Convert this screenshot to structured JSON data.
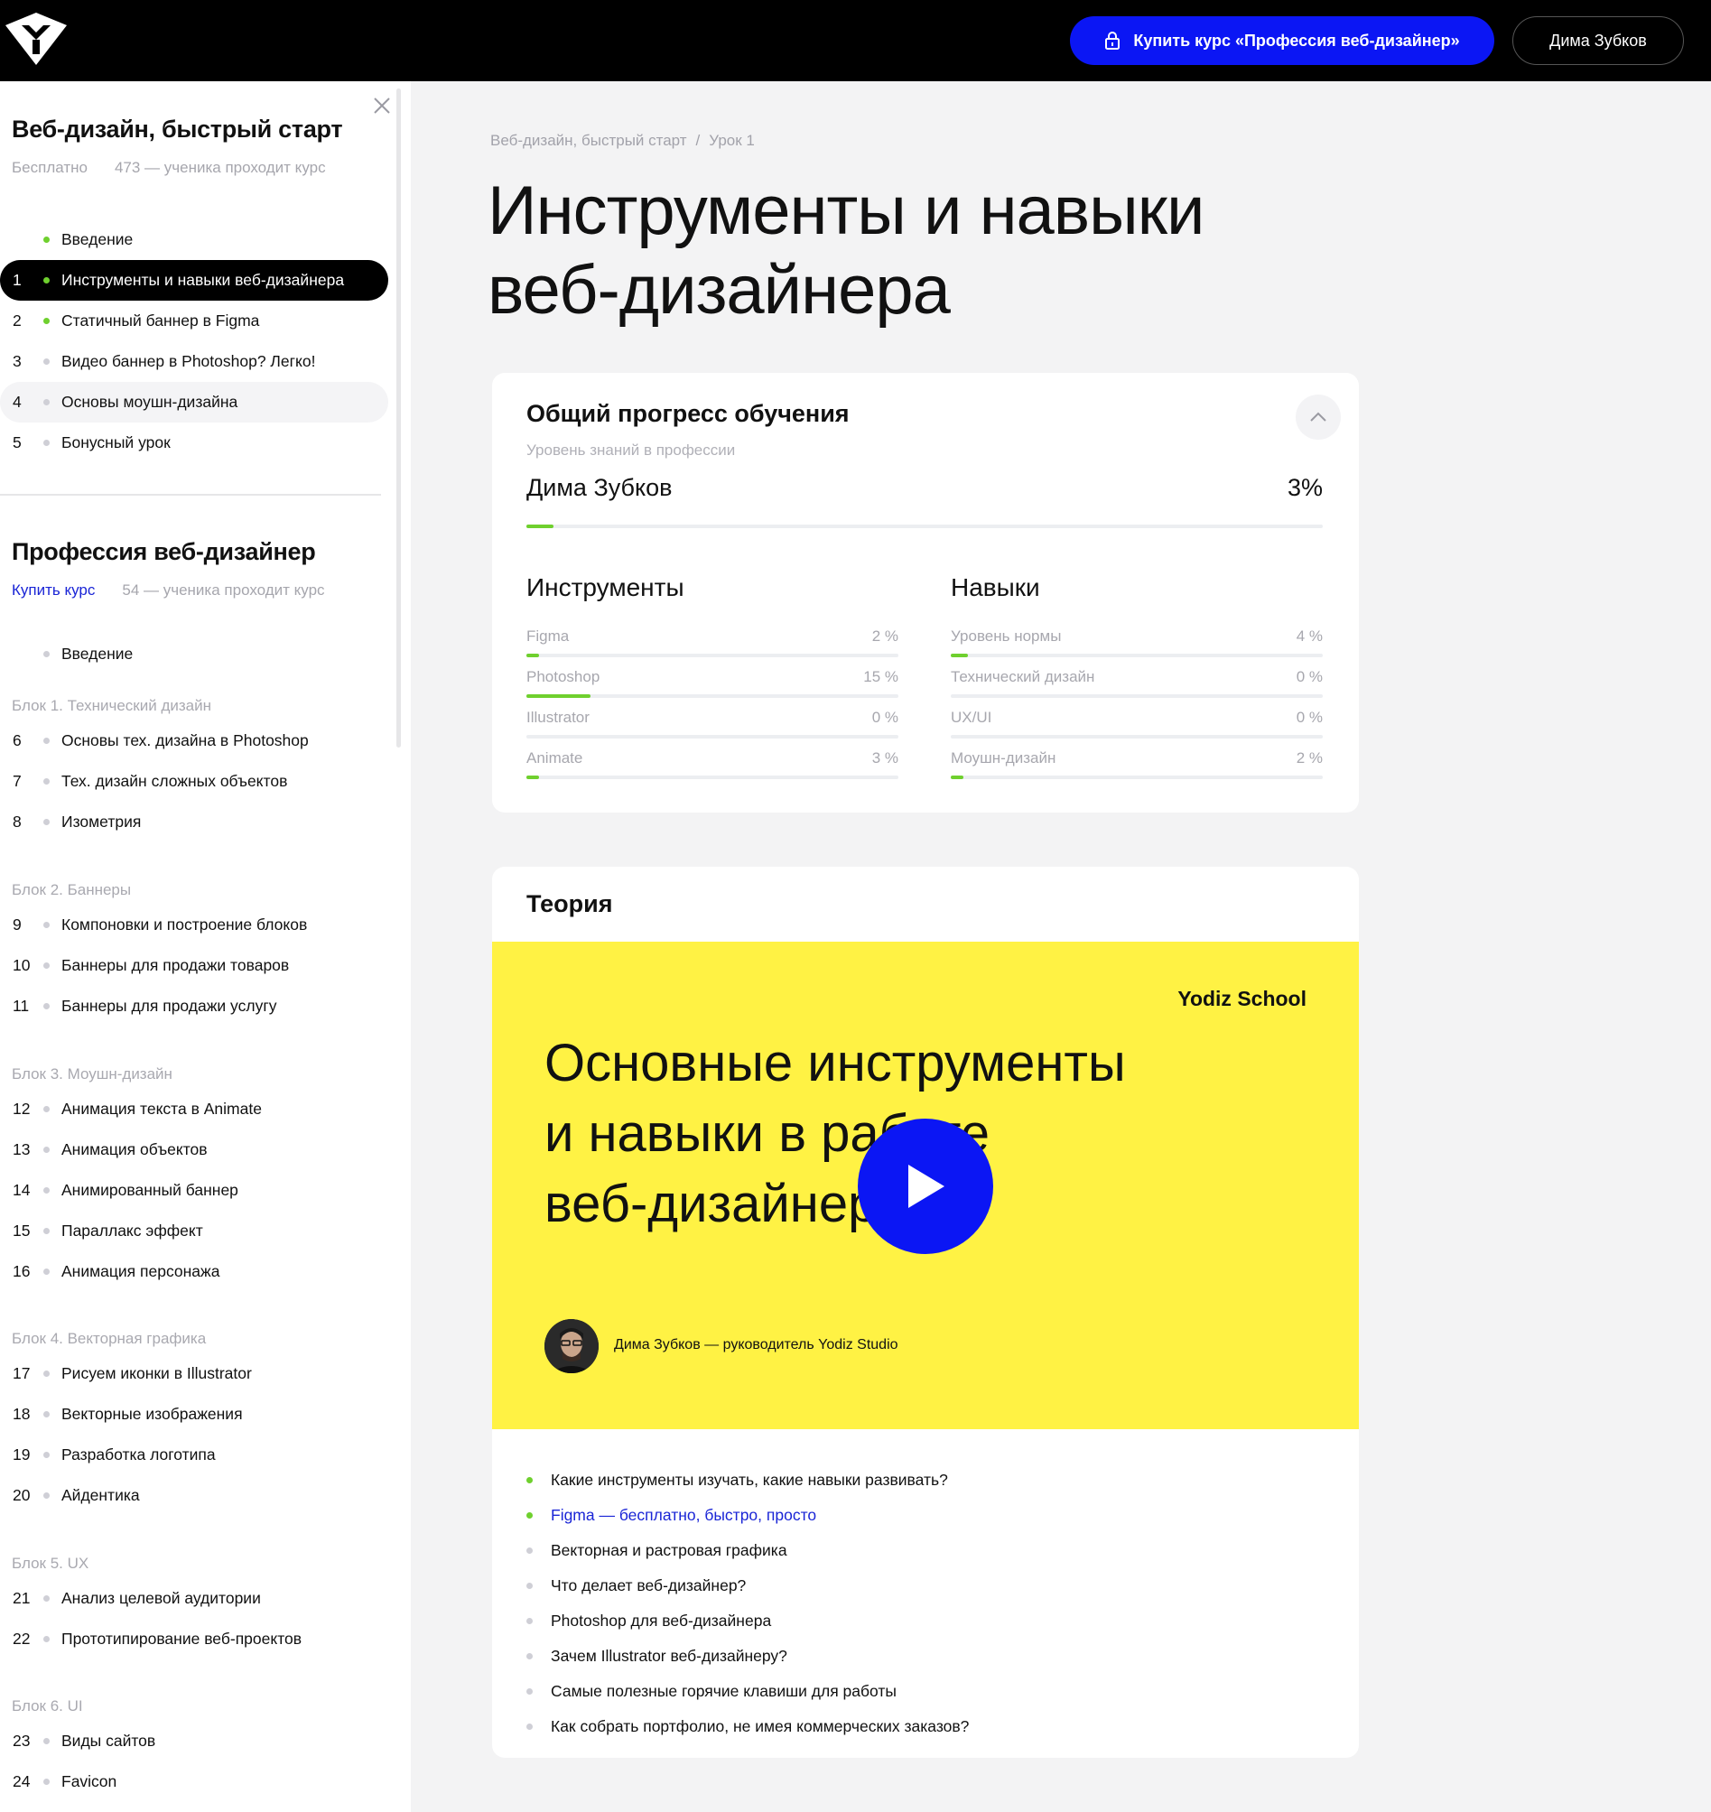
{
  "header": {
    "logo": "yodiz-logo",
    "buy_label": "Купить курс «Профессия веб-дизайнер»",
    "user_label": "Дима Зубков"
  },
  "sidebar": {
    "course1": {
      "title": "Веб-дизайн, быстрый старт",
      "price": "Бесплатно",
      "students": "473 — ученика проходит курс",
      "lessons": [
        {
          "num": "",
          "label": "Введение",
          "dot": "green"
        },
        {
          "num": "1",
          "label": "Инструменты и навыки веб-дизайнера",
          "dot": "green",
          "active": true
        },
        {
          "num": "2",
          "label": "Статичный баннер в Figma",
          "dot": "green"
        },
        {
          "num": "3",
          "label": "Видео баннер в Photoshop? Легко!",
          "dot": "grey"
        },
        {
          "num": "4",
          "label": "Основы моушн-дизайна",
          "dot": "grey"
        },
        {
          "num": "5",
          "label": "Бонусный урок",
          "dot": "grey"
        }
      ]
    },
    "course2": {
      "title": "Профессия веб-дизайнер",
      "buy": "Купить курс",
      "students": "54 — ученика проходит курс",
      "intro": "Введение",
      "blocks": [
        {
          "title": "Блок 1. Технический дизайн",
          "lessons": [
            {
              "num": "6",
              "label": "Основы тех. дизайна в Photoshop"
            },
            {
              "num": "7",
              "label": "Тех. дизайн сложных объектов"
            },
            {
              "num": "8",
              "label": "Изометрия"
            }
          ]
        },
        {
          "title": "Блок 2. Баннеры",
          "lessons": [
            {
              "num": "9",
              "label": "Компоновки и построение блоков"
            },
            {
              "num": "10",
              "label": "Баннеры для продажи товаров"
            },
            {
              "num": "11",
              "label": "Баннеры для продажи услугу"
            }
          ]
        },
        {
          "title": "Блок 3. Моушн-дизайн",
          "lessons": [
            {
              "num": "12",
              "label": "Анимация текста в Animate"
            },
            {
              "num": "13",
              "label": "Анимация объектов"
            },
            {
              "num": "14",
              "label": "Анимированный баннер"
            },
            {
              "num": "15",
              "label": "Параллакс эффект"
            },
            {
              "num": "16",
              "label": "Анимация персонажа"
            }
          ]
        },
        {
          "title": "Блок 4. Векторная графика",
          "lessons": [
            {
              "num": "17",
              "label": "Рисуем иконки в Illustrator"
            },
            {
              "num": "18",
              "label": "Векторные изображения"
            },
            {
              "num": "19",
              "label": "Разработка логотипа"
            },
            {
              "num": "20",
              "label": "Айдентика"
            }
          ]
        },
        {
          "title": "Блок 5. UX",
          "lessons": [
            {
              "num": "21",
              "label": "Анализ целевой аудитории"
            },
            {
              "num": "22",
              "label": "Прототипирование веб-проектов"
            }
          ]
        },
        {
          "title": "Блок 6. UI",
          "lessons": [
            {
              "num": "23",
              "label": "Виды сайтов"
            },
            {
              "num": "24",
              "label": "Favicon"
            }
          ]
        }
      ]
    }
  },
  "main": {
    "breadcrumb": {
      "course": "Веб-дизайн, быстрый старт",
      "sep": "/",
      "lesson": "Урок 1"
    },
    "title_line1": "Инструменты и навыки",
    "title_line2": "веб-дизайнера",
    "progress": {
      "title": "Общий прогресс обучения",
      "subtitle": "Уровень знаний в профессии",
      "name": "Дима Зубков",
      "percent_label": "3%",
      "percent": 3,
      "tools_title": "Инструменты",
      "skills_title": "Навыки",
      "tools": [
        {
          "label": "Figma",
          "value_label": "2 %",
          "value": 2
        },
        {
          "label": "Photoshop",
          "value_label": "15 %",
          "value": 15
        },
        {
          "label": "Illustrator",
          "value_label": "0 %",
          "value": 0
        },
        {
          "label": "Animate",
          "value_label": "3 %",
          "value": 3
        }
      ],
      "skills": [
        {
          "label": "Уровень нормы",
          "value_label": "4 %",
          "value": 4
        },
        {
          "label": "Технический дизайн",
          "value_label": "0 %",
          "value": 0
        },
        {
          "label": "UX/UI",
          "value_label": "0 %",
          "value": 0
        },
        {
          "label": "Моушн-дизайн",
          "value_label": "2 %",
          "value": 2
        }
      ]
    },
    "theory": {
      "title": "Теория",
      "video": {
        "brand": "Yodiz School",
        "line1": "Основные инструменты",
        "line2": "и навыки в работе",
        "line3": "веб-дизайнера",
        "author": "Дима Зубков — руководитель Yodiz Studio"
      },
      "topics": [
        {
          "label": "Какие инструменты изучать, какие навыки развивать?",
          "dot": "green"
        },
        {
          "label": "Figma — бесплатно, быстро, просто",
          "dot": "green",
          "link": true
        },
        {
          "label": "Векторная и растровая графика",
          "dot": "grey"
        },
        {
          "label": "Что делает веб-дизайнер?",
          "dot": "grey"
        },
        {
          "label": "Photoshop для веб-дизайнера",
          "dot": "grey"
        },
        {
          "label": "Зачем Illustrator веб-дизайнеру?",
          "dot": "grey"
        },
        {
          "label": "Самые полезные горячие клавиши для работы",
          "dot": "grey"
        },
        {
          "label": "Как собрать портфолио, не имея коммерческих заказов?",
          "dot": "grey"
        }
      ]
    }
  },
  "colors": {
    "accent": "#0b16f4",
    "progress": "#6fd02e",
    "video_bg": "#fff244",
    "link": "#1a25d6"
  }
}
